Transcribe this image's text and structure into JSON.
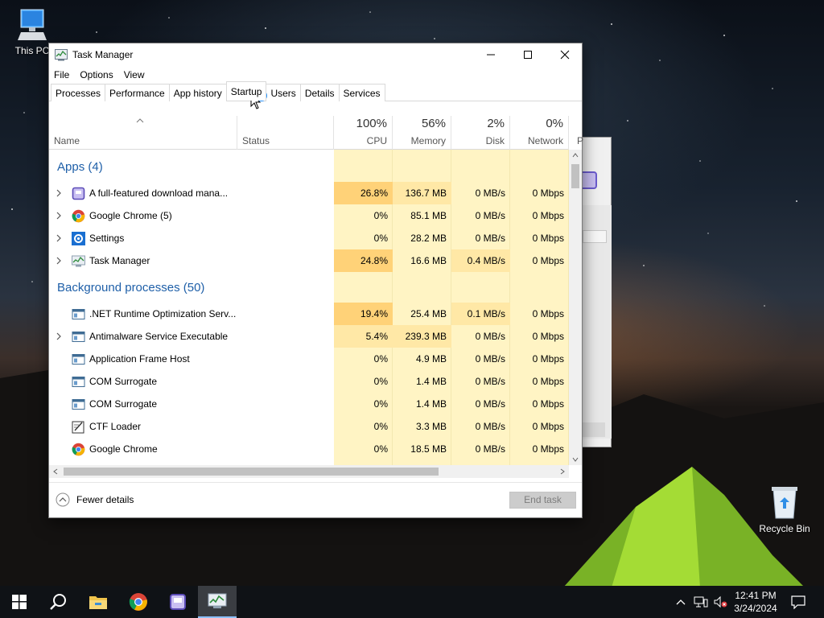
{
  "desktop": {
    "this_pc_label": "This PC",
    "recycle_bin_label": "Recycle Bin"
  },
  "window": {
    "title": "Task Manager",
    "minimize_icon": "minimize-icon",
    "maximize_icon": "maximize-icon",
    "close_icon": "close-icon"
  },
  "menu": [
    "File",
    "Options",
    "View"
  ],
  "tabs": [
    "Processes",
    "Performance",
    "App history",
    "Startup",
    "Users",
    "Details",
    "Services"
  ],
  "active_tab": "Startup",
  "columns": {
    "name": "Name",
    "status": "Status",
    "cpu": {
      "pct": "100%",
      "label": "CPU"
    },
    "memory": {
      "pct": "56%",
      "label": "Memory"
    },
    "disk": {
      "pct": "2%",
      "label": "Disk"
    },
    "network": {
      "pct": "0%",
      "label": "Network"
    },
    "partial": "P"
  },
  "groups": {
    "apps": "Apps (4)",
    "background": "Background processes (50)"
  },
  "apps": [
    {
      "name": "A full-featured download mana...",
      "cpu": "26.8%",
      "mem": "136.7 MB",
      "disk": "0 MB/s",
      "net": "0 Mbps",
      "icon": "download-manager-icon",
      "expandable": true
    },
    {
      "name": "Google Chrome (5)",
      "cpu": "0%",
      "mem": "85.1 MB",
      "disk": "0 MB/s",
      "net": "0 Mbps",
      "icon": "chrome-icon",
      "expandable": true
    },
    {
      "name": "Settings",
      "cpu": "0%",
      "mem": "28.2 MB",
      "disk": "0 MB/s",
      "net": "0 Mbps",
      "icon": "settings-gear-icon",
      "expandable": true
    },
    {
      "name": "Task Manager",
      "cpu": "24.8%",
      "mem": "16.6 MB",
      "disk": "0.4 MB/s",
      "net": "0 Mbps",
      "icon": "task-manager-icon",
      "expandable": true
    }
  ],
  "background": [
    {
      "name": ".NET Runtime Optimization Serv...",
      "cpu": "19.4%",
      "mem": "25.4 MB",
      "disk": "0.1 MB/s",
      "net": "0 Mbps",
      "icon": "service-window-icon",
      "expandable": false
    },
    {
      "name": "Antimalware Service Executable",
      "cpu": "5.4%",
      "mem": "239.3 MB",
      "disk": "0 MB/s",
      "net": "0 Mbps",
      "icon": "service-window-icon",
      "expandable": true
    },
    {
      "name": "Application Frame Host",
      "cpu": "0%",
      "mem": "4.9 MB",
      "disk": "0 MB/s",
      "net": "0 Mbps",
      "icon": "service-window-icon",
      "expandable": false
    },
    {
      "name": "COM Surrogate",
      "cpu": "0%",
      "mem": "1.4 MB",
      "disk": "0 MB/s",
      "net": "0 Mbps",
      "icon": "service-window-icon",
      "expandable": false
    },
    {
      "name": "COM Surrogate",
      "cpu": "0%",
      "mem": "1.4 MB",
      "disk": "0 MB/s",
      "net": "0 Mbps",
      "icon": "service-window-icon",
      "expandable": false
    },
    {
      "name": "CTF Loader",
      "cpu": "0%",
      "mem": "3.3 MB",
      "disk": "0 MB/s",
      "net": "0 Mbps",
      "icon": "ctf-loader-icon",
      "expandable": false
    },
    {
      "name": "Google Chrome",
      "cpu": "0%",
      "mem": "18.5 MB",
      "disk": "0 MB/s",
      "net": "0 Mbps",
      "icon": "chrome-icon",
      "expandable": false
    }
  ],
  "footer": {
    "fewer_details": "Fewer details",
    "end_task": "End task"
  },
  "taskbar": {
    "clock_time": "12:41 PM",
    "clock_date": "3/24/2024",
    "apps": [
      "start-icon",
      "search-icon",
      "file-explorer-icon",
      "chrome-icon",
      "download-manager-icon",
      "task-manager-icon"
    ]
  },
  "colors": {
    "heat_low": "#fff4c4",
    "heat_mid": "#ffe8a6",
    "heat_high": "#ffd278",
    "group_title": "#1e5fa8",
    "taskbar": "#0f1216"
  }
}
